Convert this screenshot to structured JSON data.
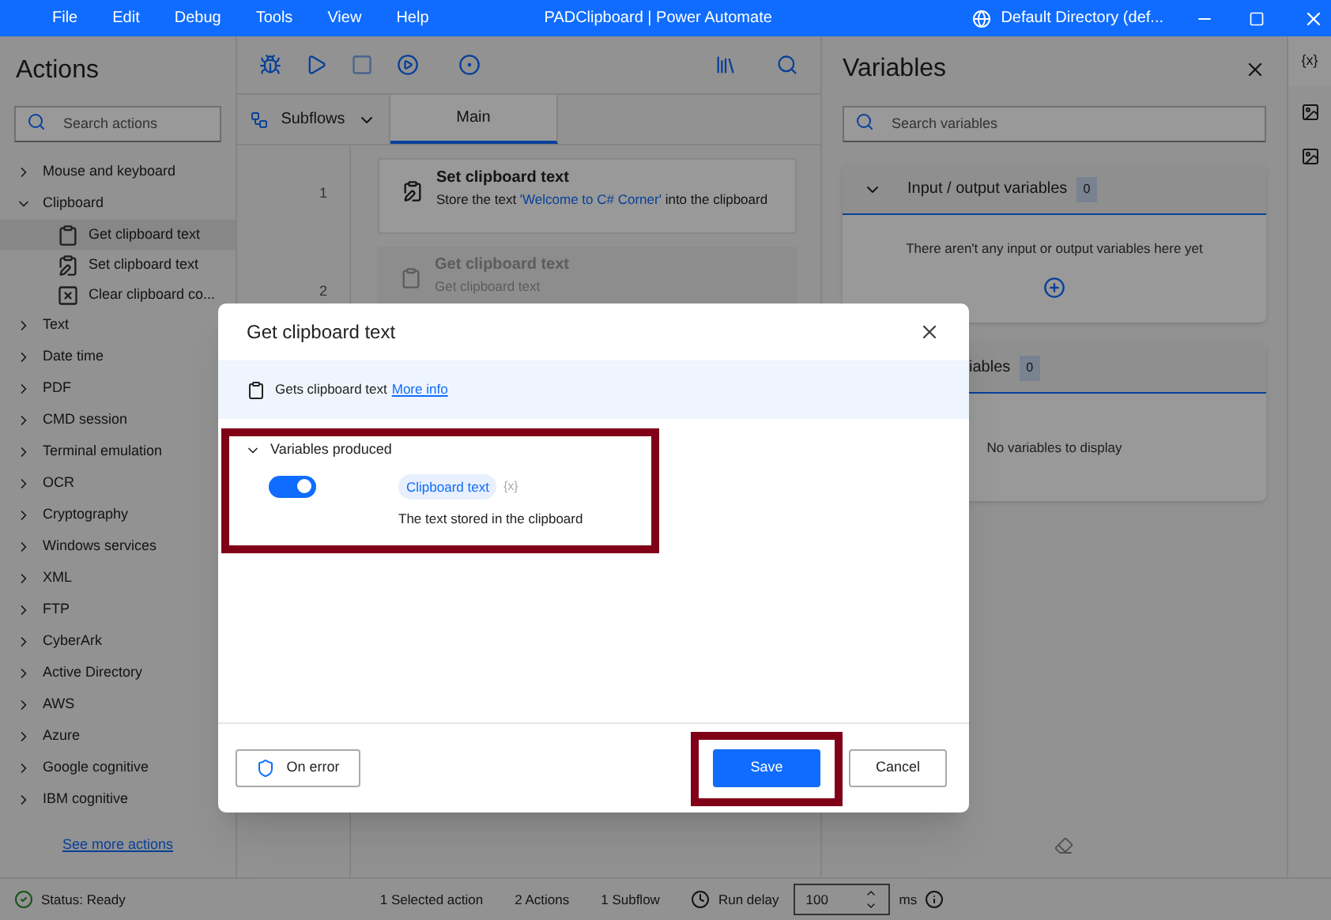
{
  "menu": [
    "File",
    "Edit",
    "Debug",
    "Tools",
    "View",
    "Help"
  ],
  "window": {
    "title": "PADClipboard | Power Automate",
    "account": "Default Directory (def..."
  },
  "actions_panel": {
    "title": "Actions",
    "search_placeholder": "Search actions",
    "see_more": "See more actions",
    "categories": [
      {
        "label": "Mouse and keyboard",
        "expanded": false
      },
      {
        "label": "Clipboard",
        "expanded": true,
        "children": [
          {
            "label": "Get clipboard text",
            "selected": true,
            "kind": "get"
          },
          {
            "label": "Set clipboard text",
            "selected": false,
            "kind": "set"
          },
          {
            "label": "Clear clipboard co...",
            "selected": false,
            "kind": "clear"
          }
        ]
      },
      {
        "label": "Text",
        "expanded": false
      },
      {
        "label": "Date time",
        "expanded": false
      },
      {
        "label": "PDF",
        "expanded": false
      },
      {
        "label": "CMD session",
        "expanded": false
      },
      {
        "label": "Terminal emulation",
        "expanded": false
      },
      {
        "label": "OCR",
        "expanded": false
      },
      {
        "label": "Cryptography",
        "expanded": false
      },
      {
        "label": "Windows services",
        "expanded": false
      },
      {
        "label": "XML",
        "expanded": false
      },
      {
        "label": "FTP",
        "expanded": false
      },
      {
        "label": "CyberArk",
        "expanded": false
      },
      {
        "label": "Active Directory",
        "expanded": false
      },
      {
        "label": "AWS",
        "expanded": false
      },
      {
        "label": "Azure",
        "expanded": false
      },
      {
        "label": "Google cognitive",
        "expanded": false
      },
      {
        "label": "IBM cognitive",
        "expanded": false
      }
    ]
  },
  "editor": {
    "tabs": [
      {
        "label": "Subflows",
        "kind": "dropdown",
        "selected": false
      },
      {
        "label": "Main",
        "kind": "tab",
        "selected": true
      }
    ],
    "steps": [
      {
        "number": "1",
        "title": "Set clipboard text",
        "desc_before": "Store the text ",
        "desc_value": "'Welcome to C# Corner'",
        "desc_after": " into the clipboard",
        "disabled": false
      },
      {
        "number": "2",
        "title": "Get clipboard text",
        "desc_before": "Get clipboard text",
        "disabled": true
      }
    ]
  },
  "variables_panel": {
    "title": "Variables",
    "search_placeholder": "Search variables",
    "sections": [
      {
        "title": "Input / output variables",
        "count": "0",
        "empty": "There aren't any input or output variables here yet",
        "addable": true
      },
      {
        "title": "iables",
        "count": "0",
        "empty": "No variables to display",
        "addable": false
      }
    ]
  },
  "side_strip": {
    "variables_label": "{x}"
  },
  "dialog": {
    "title": "Get clipboard text",
    "info": "Gets clipboard text",
    "info_link": "More info",
    "section": "Variables produced",
    "variables": [
      {
        "name": "Clipboard text",
        "marker": "{x}",
        "description": "The text stored in the clipboard",
        "on": true
      }
    ],
    "on_error": "On error",
    "save": "Save",
    "cancel": "Cancel"
  },
  "status_bar": {
    "status": "Status: Ready",
    "selected": "1 Selected action",
    "actions": "2 Actions",
    "subflows": "1 Subflow",
    "run_delay_label": "Run delay",
    "run_delay": "100",
    "unit": "ms"
  }
}
